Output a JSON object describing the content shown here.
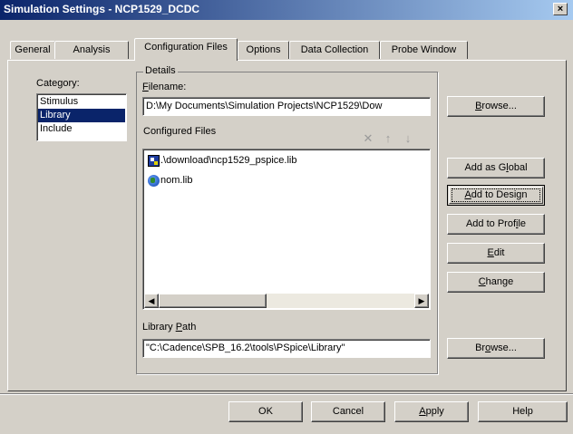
{
  "window": {
    "title": "Simulation Settings - NCP1529_DCDC",
    "close_glyph": "×"
  },
  "tabs": [
    {
      "label": "General",
      "active": false
    },
    {
      "label": "Analysis",
      "active": false
    },
    {
      "label": "Configuration Files",
      "active": true
    },
    {
      "label": "Options",
      "active": false
    },
    {
      "label": "Data Collection",
      "active": false
    },
    {
      "label": "Probe Window",
      "active": false
    }
  ],
  "category": {
    "label_pre": "Cate",
    "label_u": "g",
    "label_post": "ory:",
    "items": [
      {
        "label": "Stimulus",
        "selected": false
      },
      {
        "label": "Library",
        "selected": true
      },
      {
        "label": "Include",
        "selected": false
      }
    ]
  },
  "details": {
    "group_title": "Details",
    "filename_label_u": "F",
    "filename_label_post": "ilename:",
    "filename_value": "D:\\My Documents\\Simulation Projects\\NCP1529\\Dow",
    "configured_files_label": "Configured Files",
    "toolbar_glyphs": {
      "delete": "✕",
      "up": "↑",
      "down": "↓"
    },
    "files": [
      {
        "name": ".\\download\\ncp1529_pspice.lib",
        "icon": "local-library-icon"
      },
      {
        "name": "nom.lib",
        "icon": "global-library-icon"
      }
    ],
    "library_path_label_pre": "Library ",
    "library_path_label_u": "P",
    "library_path_label_post": "ath",
    "library_path_value": "\"C:\\Cadence\\SPB_16.2\\tools\\PSpice\\Library\""
  },
  "buttons": {
    "browse1": {
      "u": "B",
      "post": "rowse..."
    },
    "add_global": {
      "pre": "Add as G",
      "u": "l",
      "post": "obal"
    },
    "add_design": {
      "pre": "",
      "u": "A",
      "post": "dd to Design"
    },
    "add_profile": {
      "pre": "Add to Prof",
      "u": "i",
      "post": "le"
    },
    "edit": {
      "pre": "",
      "u": "E",
      "post": "dit"
    },
    "change": {
      "pre": "",
      "u": "C",
      "post": "hange"
    },
    "browse2": {
      "pre": "Br",
      "u": "o",
      "post": "wse..."
    }
  },
  "footer": {
    "ok": "OK",
    "cancel": "Cancel",
    "apply": {
      "u": "A",
      "post": "pply"
    },
    "help": "Help"
  },
  "scrollbar": {
    "left_glyph": "◀",
    "right_glyph": "▶"
  }
}
